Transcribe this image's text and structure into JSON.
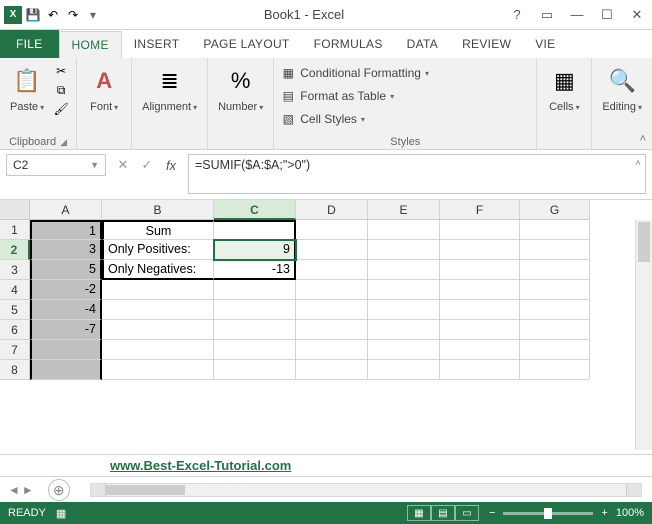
{
  "title": "Book1 - Excel",
  "tabs": {
    "file": "FILE",
    "home": "HOME",
    "insert": "INSERT",
    "pagelayout": "PAGE LAYOUT",
    "formulas": "FORMULAS",
    "data": "DATA",
    "review": "REVIEW",
    "view": "VIE"
  },
  "ribbon": {
    "clipboard": {
      "paste": "Paste",
      "label": "Clipboard"
    },
    "font": {
      "btn": "Font"
    },
    "alignment": {
      "btn": "Alignment"
    },
    "number": {
      "btn": "Number"
    },
    "styles": {
      "cond": "Conditional Formatting",
      "table": "Format as Table",
      "cell": "Cell Styles",
      "label": "Styles"
    },
    "cells": {
      "btn": "Cells"
    },
    "editing": {
      "btn": "Editing"
    }
  },
  "formula_bar": {
    "name_box": "C2",
    "formula": "=SUMIF($A:$A;\">0\")"
  },
  "columns": [
    "A",
    "B",
    "C",
    "D",
    "E",
    "F",
    "G"
  ],
  "rows_a": [
    "1",
    "3",
    "5",
    "-2",
    "-4",
    "-7",
    "",
    ""
  ],
  "b1": "Sum",
  "b2": "Only Positives:",
  "b3": "Only Negatives:",
  "c2": "9",
  "c3": "-13",
  "link": "www.Best-Excel-Tutorial.com",
  "status": {
    "ready": "READY",
    "zoom": "100%"
  },
  "chart_data": {
    "type": "table",
    "columns": [
      "A",
      "B",
      "C"
    ],
    "rows": [
      [
        "1",
        "Sum",
        ""
      ],
      [
        "3",
        "Only Positives:",
        "9"
      ],
      [
        "5",
        "Only Negatives:",
        "-13"
      ],
      [
        "-2",
        "",
        ""
      ],
      [
        "-4",
        "",
        ""
      ],
      [
        "-7",
        "",
        ""
      ],
      [
        "",
        "",
        ""
      ],
      [
        "",
        "",
        ""
      ]
    ],
    "active_cell": "C2",
    "formula": "=SUMIF($A:$A;\">0\")"
  }
}
